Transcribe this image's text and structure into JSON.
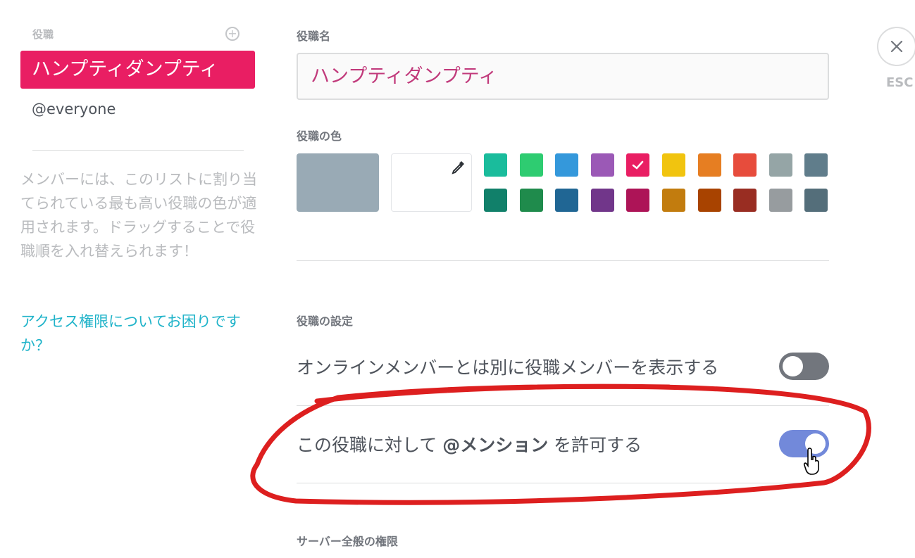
{
  "sidebar": {
    "header": "役職",
    "add_icon": "plus-circle-icon",
    "roles": [
      {
        "label": "ハンプティダンプティ",
        "selected": true,
        "color": "#e91e63"
      },
      {
        "label": "@everyone",
        "selected": false
      }
    ],
    "hint": "メンバーには、このリストに割り当てられている最も高い役職の色が適用されます。ドラッグすることで役職順を入れ替えられます！",
    "help_link": "アクセス権限についてお困りですか？"
  },
  "main": {
    "role_name_label": "役職名",
    "role_name_value": "ハンプティダンプティ",
    "role_color_label": "役職の色",
    "default_color": "#99aab5",
    "selected_color": "#e91e63",
    "swatches_row1": [
      "#1abc9c",
      "#2ecc71",
      "#3498db",
      "#9b59b6",
      "#e91e63",
      "#f1c40f",
      "#e67e22",
      "#e74c3c",
      "#95a5a6",
      "#607d8b"
    ],
    "swatches_row2": [
      "#11806a",
      "#1f8b4c",
      "#206694",
      "#71368a",
      "#ad1457",
      "#c27c0e",
      "#a84300",
      "#992d22",
      "#979c9f",
      "#546e7a"
    ],
    "role_settings_label": "役職の設定",
    "settings": [
      {
        "text": "オンラインメンバーとは別に役職メンバーを表示する",
        "enabled": false
      },
      {
        "prefix": "この役職に対して ",
        "bold": "@メンション",
        "suffix": " を許可する",
        "enabled": true
      }
    ],
    "general_permissions_label": "サーバー全般の権限"
  },
  "close": {
    "icon": "close-icon",
    "esc_label": "ESC"
  },
  "annotation": {
    "color": "#dd1f1f"
  }
}
